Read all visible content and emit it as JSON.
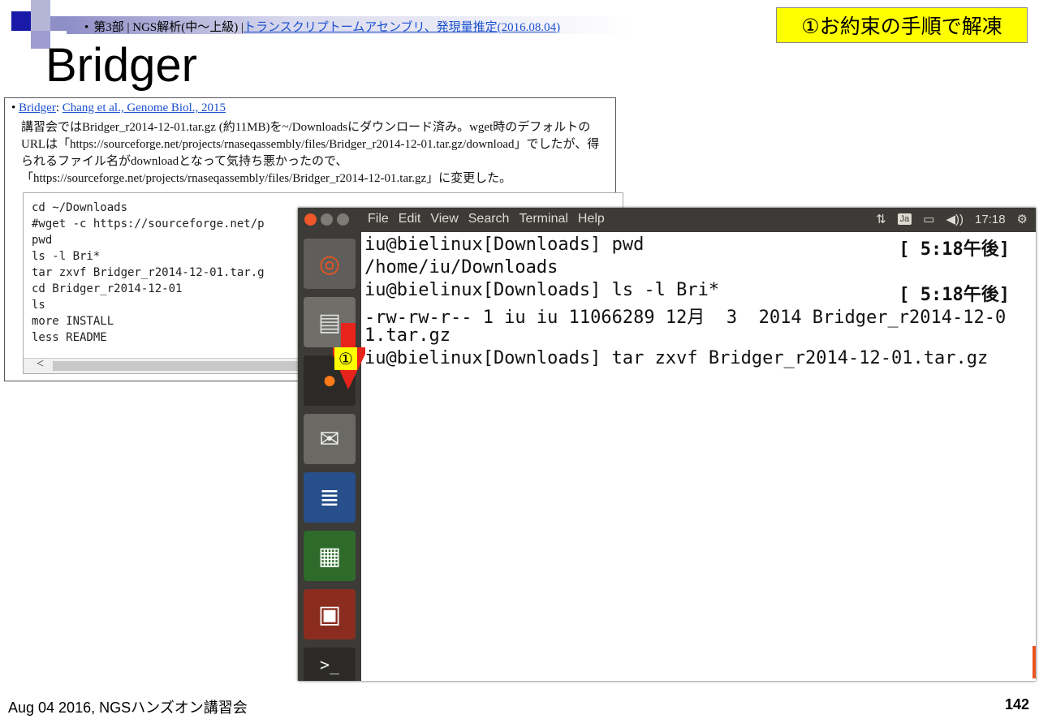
{
  "header": {
    "bullet": "•",
    "breadcrumb_prefix": "第3部 | NGS解析(中～上級) |",
    "breadcrumb_link": "トランスクリプトームアセンブリ、発現量推定(2016.08.04)"
  },
  "callout": "①お約束の手順で解凍",
  "title": "Bridger",
  "info": {
    "bullet": "•",
    "ref_tool": "Bridger",
    "ref_sep": ":",
    "ref_paper": "Chang et al., Genome Biol., 2015",
    "paragraph": "講習会ではBridger_r2014-12-01.tar.gz (約11MB)を~/Downloadsにダウンロード済み。wget時のデフォルトのURLは「https://sourceforge.net/projects/rnaseqassembly/files/Bridger_r2014-12-01.tar.gz/download」でしたが、得られるファイル名がdownloadとなって気持ち悪かったので、「https://sourceforge.net/projects/rnaseqassembly/files/Bridger_r2014-12-01.tar.gz」に変更した。",
    "code_lines": [
      "cd ~/Downloads",
      "#wget -c https://sourceforge.net/p",
      "pwd",
      "ls -l Bri*",
      "tar zxvf Bridger_r2014-12-01.tar.g",
      "cd Bridger_r2014-12-01",
      "ls",
      "more INSTALL",
      "less README"
    ],
    "scroll_left": "<"
  },
  "terminal": {
    "menu": [
      "File",
      "Edit",
      "View",
      "Search",
      "Terminal",
      "Help"
    ],
    "tray": {
      "network": "⇅",
      "lang": "Ja",
      "battery": "▭",
      "volume": "◀))",
      "time": "17:18",
      "settings": "⚙"
    },
    "lines": [
      "iu@bielinux[Downloads] pwd",
      "/home/iu/Downloads",
      "iu@bielinux[Downloads] ls -l Bri*",
      "-rw-rw-r-- 1 iu iu 11066289 12月  3  2014 Bridger_r2014-12-0",
      "1.tar.gz",
      "iu@bielinux[Downloads] tar zxvf Bridger_r2014-12-01.tar.gz"
    ],
    "timestamps": [
      "[ 5:18午後]",
      "[ 5:18午後]"
    ],
    "launcher": [
      {
        "icon": "ubuntu-icon",
        "glyph": "◎"
      },
      {
        "icon": "files-icon",
        "glyph": "▤"
      },
      {
        "icon": "firefox-icon",
        "glyph": "●"
      },
      {
        "icon": "mail-icon",
        "glyph": "✉"
      },
      {
        "icon": "writer-icon",
        "glyph": "≣"
      },
      {
        "icon": "calc-icon",
        "glyph": "▦"
      },
      {
        "icon": "impress-icon",
        "glyph": "▣"
      },
      {
        "icon": "terminal-icon",
        "glyph": ">_"
      }
    ]
  },
  "marker": "①",
  "footer": "Aug 04 2016, NGSハンズオン講習会",
  "page_number": "142",
  "colors": {
    "accent_red": "#e8231c",
    "callout_yellow": "#ffff00",
    "terminal_bar": "#3c3b37"
  }
}
